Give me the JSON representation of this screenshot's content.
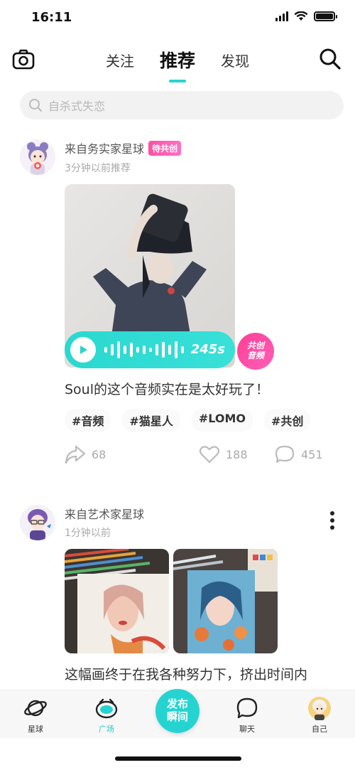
{
  "status_bar": {
    "time": "16:11"
  },
  "top_nav": {
    "tabs": [
      {
        "label": "关注",
        "active": false
      },
      {
        "label": "推荐",
        "active": true
      },
      {
        "label": "发现",
        "active": false
      }
    ]
  },
  "search": {
    "placeholder": "自杀式失恋"
  },
  "posts": [
    {
      "source": "来自务实家星球",
      "badge": "待共创",
      "time": "3分钟以前推荐",
      "audio": {
        "duration": "245s"
      },
      "cocreate_badge": {
        "line1": "共创",
        "line2": "音频"
      },
      "text": "Soul的这个音频实在是太好玩了！",
      "tags": [
        "#音频",
        "#猫星人",
        "#LOMO",
        "#共创"
      ],
      "likes_label": "188",
      "comments_label": "451",
      "shares_label": "68"
    },
    {
      "source": "来自艺术家星球",
      "time": "1分钟以前",
      "text": "这幅画终于在我各种努力下，挤出时间内"
    }
  ],
  "tab_bar": {
    "items": [
      {
        "label": "星球",
        "icon": "planet-icon"
      },
      {
        "label": "广场",
        "icon": "square-icon",
        "active": true
      },
      {
        "label": "聊天",
        "icon": "chat-icon"
      },
      {
        "label": "自己",
        "icon": "profile-avatar"
      }
    ],
    "publish": {
      "line1": "发布",
      "line2": "瞬间"
    }
  },
  "colors": {
    "accent": "#25d4d0",
    "badge_pink": "#ff4fa0",
    "text_muted": "#aaaaaa"
  }
}
